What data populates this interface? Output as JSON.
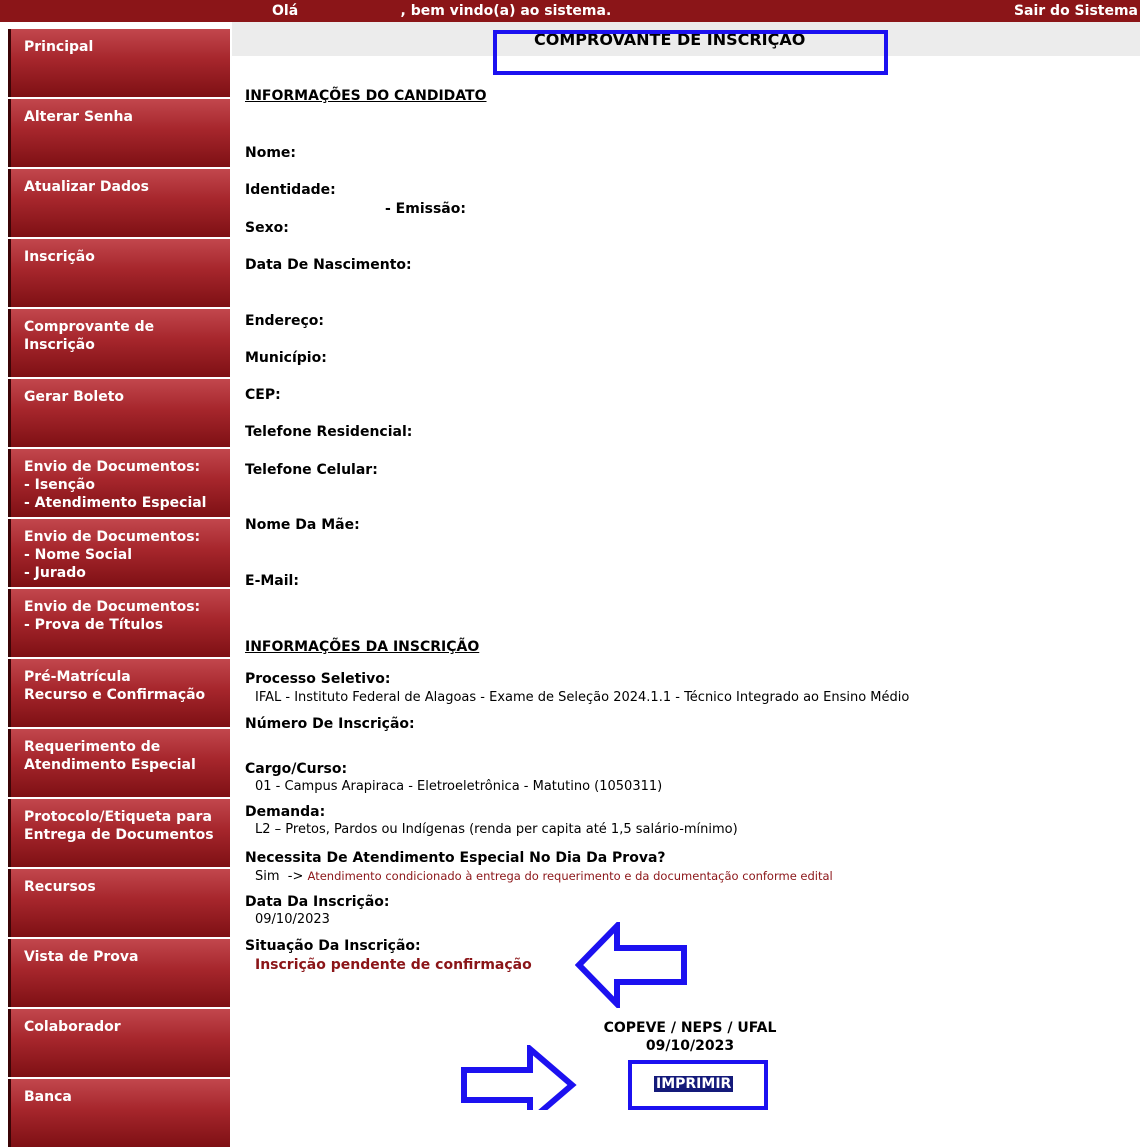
{
  "header": {
    "greeting_prefix": "Olá",
    "greeting_suffix": ", bem vindo(a) ao sistema.",
    "logout": "Sair do Sistema"
  },
  "sidebar": {
    "items": [
      {
        "lines": [
          "Principal"
        ]
      },
      {
        "lines": [
          "Alterar Senha"
        ]
      },
      {
        "lines": [
          "Atualizar Dados"
        ]
      },
      {
        "lines": [
          "Inscrição"
        ]
      },
      {
        "lines": [
          "Comprovante de",
          "Inscrição"
        ]
      },
      {
        "lines": [
          "Gerar Boleto"
        ]
      },
      {
        "lines": [
          "Envio de Documentos:",
          "- Isenção",
          "- Atendimento Especial"
        ]
      },
      {
        "lines": [
          "Envio de Documentos:",
          "- Nome Social",
          "- Jurado"
        ]
      },
      {
        "lines": [
          "Envio de Documentos:",
          "- Prova de Títulos"
        ]
      },
      {
        "lines": [
          "Pré-Matrícula",
          "Recurso e Confirmação"
        ]
      },
      {
        "lines": [
          "Requerimento de",
          "Atendimento Especial"
        ]
      },
      {
        "lines": [
          "Protocolo/Etiqueta para",
          "Entrega de Documentos"
        ]
      },
      {
        "lines": [
          "Recursos"
        ]
      },
      {
        "lines": [
          "Vista de Prova"
        ]
      },
      {
        "lines": [
          "Colaborador"
        ]
      },
      {
        "lines": [
          "Banca"
        ]
      }
    ]
  },
  "main": {
    "title": "COMPROVANTE DE INSCRIÇÃO",
    "candidate_section": "INFORMAÇÕES DO CANDIDATO",
    "labels": {
      "nome": "Nome:",
      "identidade": "Identidade:",
      "emissao": "- Emissão:",
      "sexo": "Sexo:",
      "nascimento": "Data De Nascimento:",
      "endereco": "Endereço:",
      "municipio": "Município:",
      "cep": "CEP:",
      "tel_res": "Telefone Residencial:",
      "tel_cel": "Telefone Celular:",
      "mae": "Nome Da Mãe:",
      "email": "E-Mail:"
    },
    "registration_section": "INFORMAÇÕES DA INSCRIÇÃO",
    "registration": {
      "processo_label": "Processo Seletivo:",
      "processo_value": "IFAL - Instituto Federal de Alagoas - Exame de Seleção 2024.1.1 - Técnico Integrado ao Ensino Médio",
      "numero_label": "Número De Inscrição:",
      "cargo_label": "Cargo/Curso:",
      "cargo_value": "01 - Campus Arapiraca - Eletroeletrônica - Matutino (1050311)",
      "demanda_label": "Demanda:",
      "demanda_value": "L2 – Pretos, Pardos ou Indígenas (renda per capita até 1,5 salário-mínimo)",
      "atendimento_label": "Necessita De Atendimento Especial No Dia Da Prova?",
      "atendimento_value": "Sim",
      "atendimento_arrow": "->",
      "atendimento_note": "Atendimento condicionado à entrega do requerimento e da documentação conforme edital",
      "data_label": "Data Da Inscrição:",
      "data_value": "09/10/2023",
      "situacao_label": "Situação Da Inscrição:",
      "situacao_value": "Inscrição pendente de confirmação"
    },
    "footer_org": "COPEVE / NEPS / UFAL",
    "footer_date": "09/10/2023",
    "print_label": "IMPRIMIR"
  }
}
